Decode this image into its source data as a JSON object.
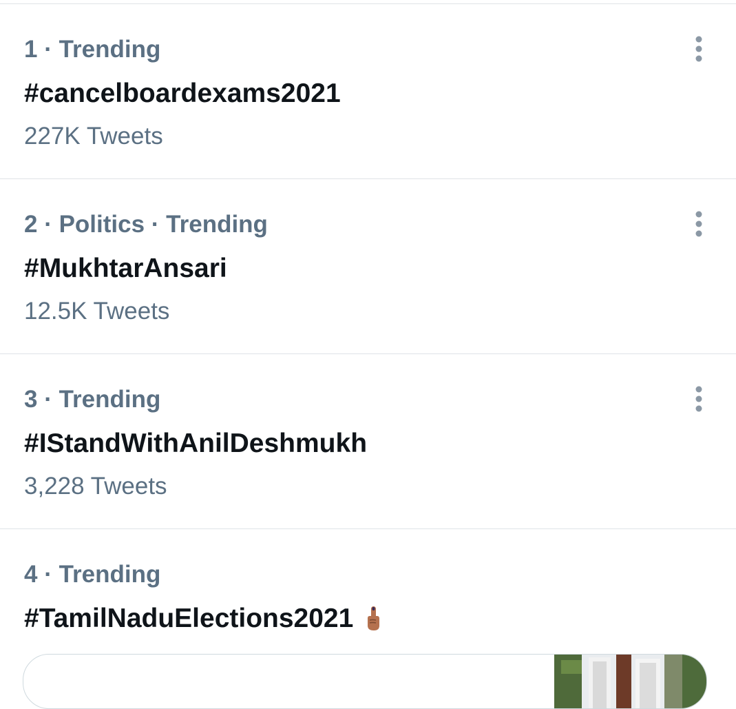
{
  "trends": [
    {
      "meta": "1 · Trending",
      "tag": "#cancelboardexams2021",
      "count": "227K Tweets"
    },
    {
      "meta": "2 · Politics · Trending",
      "tag": "#MukhtarAnsari",
      "count": "12.5K Tweets"
    },
    {
      "meta": "3 · Trending",
      "tag": "#IStandWithAnilDeshmukh",
      "count": "3,228 Tweets"
    },
    {
      "meta": "4 · Trending",
      "tag": "#TamilNaduElections2021",
      "count": "",
      "emoji": "index-finger-ink-mark-icon"
    }
  ],
  "icons": {
    "more": "vertical-ellipsis-icon"
  },
  "colors": {
    "secondary_text": "#5b7083",
    "primary_text": "#0f1419",
    "divider": "#dfe3e7"
  }
}
